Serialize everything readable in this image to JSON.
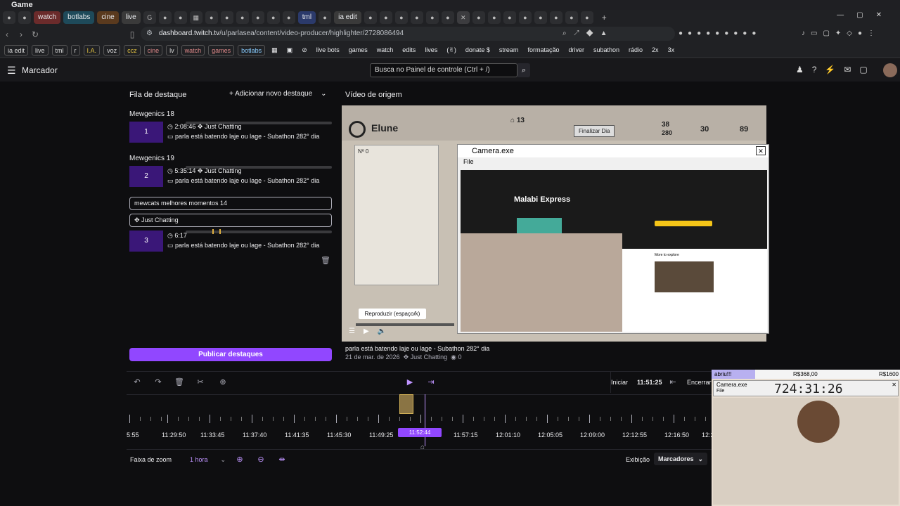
{
  "window": {
    "title": "Game"
  },
  "tabs": [
    {
      "label": "watch",
      "color": "#6b2b2b"
    },
    {
      "label": "botlabs",
      "color": "#1e4a5a"
    },
    {
      "label": "cine",
      "color": "#5a3a1e"
    },
    {
      "label": "live",
      "color": "#3a3a3a"
    },
    {
      "label": "tml",
      "color": "#2b3a6b"
    },
    {
      "label": "ia edit",
      "color": "#3a3a3a"
    }
  ],
  "address": {
    "domain": "dashboard.twitch.tv",
    "path": "/u/parlasea/content/video-producer/highlighter/2728086494"
  },
  "bookmarks": [
    "ia edit",
    "live",
    "tml",
    "r",
    "I.A.",
    "voz",
    "ccz",
    "cine",
    "lv",
    "watch",
    "games",
    "botlabs",
    "live bots",
    "games",
    "watch",
    "edits",
    "lives",
    "(✌︎)",
    "donate $",
    "stream",
    "formatação",
    "driver",
    "subathon",
    "rádio",
    "2x",
    "3x"
  ],
  "header": {
    "title": "Marcador",
    "search_placeholder": "Busca no Painel de controle (Ctrl + /)"
  },
  "queue": {
    "title": "Fila de destaque",
    "add_label": "Adicionar novo destaque",
    "groups": [
      {
        "name": "Mewgenics 18",
        "index": "1",
        "duration": "2:08:46",
        "category": "Just Chatting",
        "subtitle": "parla está batendo laje ou lage - Subathon 282° dia"
      },
      {
        "name": "Mewgenics 19",
        "index": "2",
        "duration": "5:35:14",
        "category": "Just Chatting",
        "subtitle": "parla está batendo laje ou lage - Subathon 282° dia"
      },
      {
        "name": "mewcats melhores momentos 14",
        "index": "3",
        "duration": "6:17",
        "category": "Just Chatting",
        "subtitle": "parla está batendo laje ou lage - Subathon 282° dia"
      }
    ],
    "publish_label": "Publicar destaques"
  },
  "source": {
    "title": "Vídeo de origem",
    "tooltip": "Reproduzir (espaço/k)",
    "video_title": "parla está batendo laje ou lage - Subathon 282° dia",
    "date": "21 de mar. de 2026",
    "category": "Just Chatting",
    "views": "0"
  },
  "game": {
    "name": "Elune",
    "ap": "13",
    "stat1": "38",
    "stat1b": "280",
    "stat2": "30",
    "stat3": "89",
    "finish": "Finalizar Dia",
    "no": "Nº 0"
  },
  "camera": {
    "title": "Camera.exe",
    "menu": "File",
    "movie": "Malabi Express",
    "more": "More to explore"
  },
  "timeline": {
    "start_label": "Iniciar",
    "start_time": "11:51:25",
    "end_label": "Encerrar",
    "current": "11:52:44",
    "labels": [
      "5:55",
      "11:29:50",
      "11:33:45",
      "11:37:40",
      "11:41:35",
      "11:45:30",
      "11:49:25",
      "11:57:15",
      "12:01:10",
      "12:05:05",
      "12:09:00",
      "12:12:55",
      "12:16:50",
      "12:2"
    ],
    "zoom_label": "Faixa de zoom",
    "zoom_value": "1 hora",
    "view_label": "Exibição",
    "markers_label": "Marcadores"
  },
  "overlay": {
    "badge": "abriu!!!",
    "amount1": "R$368,00",
    "amount2": "R$1600",
    "window": "Camera.exe",
    "timer": "724:31:26",
    "menu": "File"
  },
  "colors": {
    "accent": "#9147ff",
    "background": "#0e0e10",
    "thumb": "#3a1778"
  }
}
